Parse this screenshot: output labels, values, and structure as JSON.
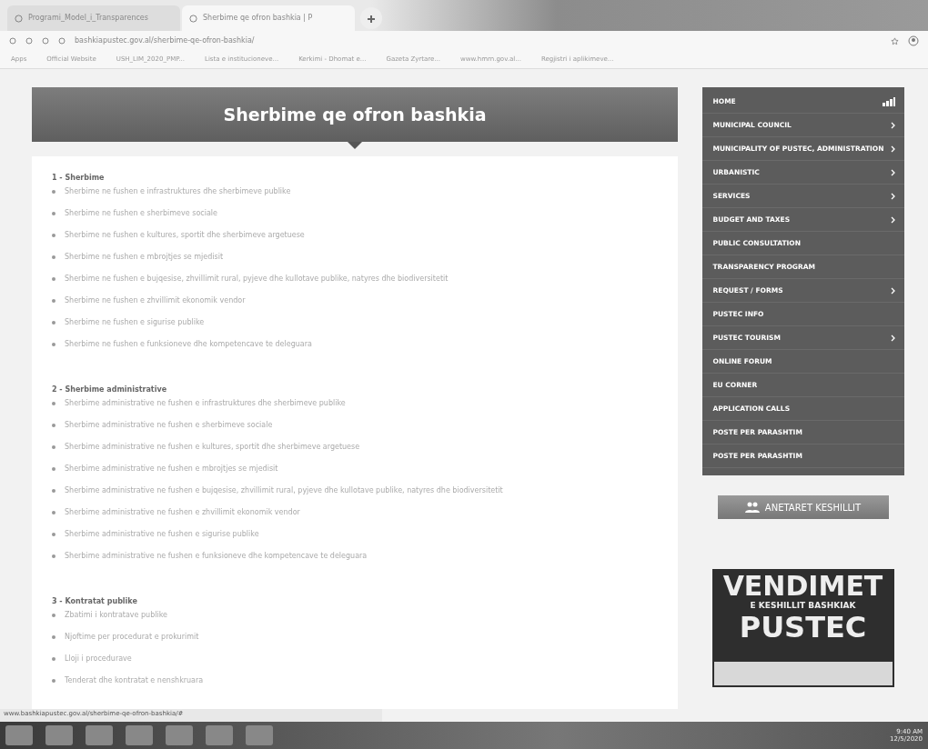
{
  "browser": {
    "tabs": [
      {
        "title": "Programi_Model_i_Transparences",
        "selected": false
      },
      {
        "title": "Sherbime qe ofron bashkia | P",
        "selected": true
      }
    ],
    "url": "bashkiapustec.gov.al/sherbime-qe-ofron-bashkia/",
    "bookmarks": [
      "Apps",
      "Official Website",
      "USH_LIM_2020_PMP...",
      "Lista e institucioneve...",
      "Kerkimi - Dhomat e...",
      "Gazeta Zyrtare...",
      "www.hmrn.gov.al...",
      "Regjistri i aplikimeve..."
    ]
  },
  "page": {
    "title": "Sherbime qe ofron bashkia",
    "sections": [
      {
        "heading": "1 - Sherbime",
        "items": [
          "Sherbime ne fushen e infrastruktures dhe sherbimeve publike",
          "Sherbime ne fushen e sherbimeve sociale",
          "Sherbime ne fushen e kultures, sportit dhe sherbimeve argetuese",
          "Sherbime ne fushen e mbrojtjes se mjedisit",
          "Sherbime ne fushen e bujqesise, zhvillimit rural, pyjeve dhe kullotave publike, natyres dhe biodiversitetit",
          "Sherbime ne fushen e zhvillimit ekonomik vendor",
          "Sherbime ne fushen e sigurise publike",
          "Sherbime ne fushen e funksioneve dhe kompetencave te deleguara"
        ]
      },
      {
        "heading": "2 - Sherbime administrative",
        "items": [
          "Sherbime administrative ne fushen e infrastruktures dhe sherbimeve publike",
          "Sherbime administrative ne fushen e sherbimeve sociale",
          "Sherbime administrative ne fushen e kultures, sportit dhe sherbimeve argetuese",
          "Sherbime administrative ne fushen e mbrojtjes se mjedisit",
          "Sherbime administrative ne fushen e bujqesise, zhvillimit rural, pyjeve dhe kullotave publike, natyres dhe biodiversitetit",
          "Sherbime administrative ne fushen e zhvillimit ekonomik vendor",
          "Sherbime administrative ne fushen e sigurise publike",
          "Sherbime administrative ne fushen e funksioneve dhe kompetencave te deleguara"
        ]
      },
      {
        "heading": "3 - Kontratat publike",
        "items": [
          "Zbatimi i kontratave publike",
          "Njoftime per procedurat e prokurimit",
          "Lloji i procedurave",
          "Tenderat dhe kontratat e nenshkruara"
        ]
      }
    ]
  },
  "menu": [
    {
      "label": "HOME",
      "has_submenu": false
    },
    {
      "label": "MUNICIPAL COUNCIL",
      "has_submenu": true
    },
    {
      "label": "MUNICIPALITY OF PUSTEC, ADMINISTRATION",
      "has_submenu": true
    },
    {
      "label": "URBANISTIC",
      "has_submenu": true
    },
    {
      "label": "SERVICES",
      "has_submenu": true
    },
    {
      "label": "BUDGET AND TAXES",
      "has_submenu": true
    },
    {
      "label": "PUBLIC CONSULTATION",
      "has_submenu": false
    },
    {
      "label": "TRANSPARENCY PROGRAM",
      "has_submenu": false
    },
    {
      "label": "REQUEST / FORMS",
      "has_submenu": true
    },
    {
      "label": "PUSTEC INFO",
      "has_submenu": false
    },
    {
      "label": "PUSTEC TOURISM",
      "has_submenu": true
    },
    {
      "label": "ONLINE FORUM",
      "has_submenu": false
    },
    {
      "label": "EU CORNER",
      "has_submenu": false
    },
    {
      "label": "APPLICATION CALLS",
      "has_submenu": false
    },
    {
      "label": "POSTE PER PARASHTIM",
      "has_submenu": false
    },
    {
      "label": "POSTE PER PARASHTIM",
      "has_submenu": false
    }
  ],
  "members_button": "ANETARET KESHILLIT",
  "banner": {
    "title": "VENDIMET",
    "subtitle": "E KESHILLIT BASHKIAK",
    "name": "PUSTEC"
  },
  "status_url": "www.bashkiapustec.gov.al/sherbime-qe-ofron-bashkia/#",
  "taskbar": {
    "time": "9:40 AM",
    "date": "12/5/2020"
  }
}
